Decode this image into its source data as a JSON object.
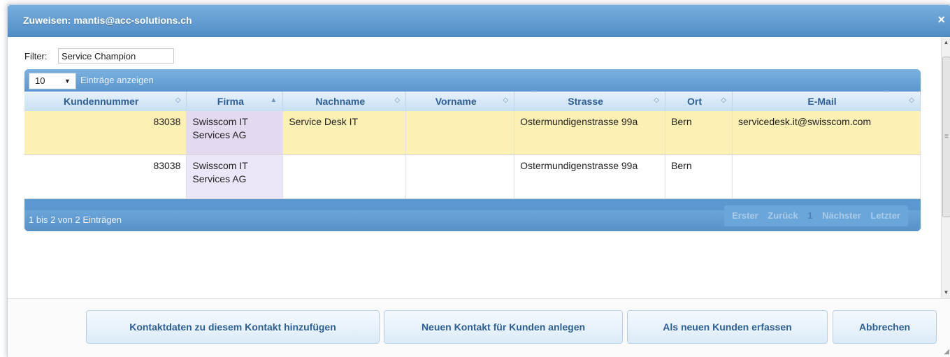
{
  "dialog": {
    "title": "Zuweisen: mantis@acc-solutions.ch",
    "close_glyph": "×"
  },
  "filter": {
    "label": "Filter:",
    "value": "Service Champion"
  },
  "table": {
    "page_size": "10",
    "page_size_label": "Einträge anzeigen",
    "columns": [
      {
        "label": "Kundennummer",
        "sort": "both"
      },
      {
        "label": "Firma",
        "sort": "asc"
      },
      {
        "label": "Nachname",
        "sort": "both"
      },
      {
        "label": "Vorname",
        "sort": "both"
      },
      {
        "label": "Strasse",
        "sort": "both"
      },
      {
        "label": "Ort",
        "sort": "both"
      },
      {
        "label": "E-Mail",
        "sort": "both"
      }
    ],
    "sort_glyphs": {
      "both": "◇",
      "asc": "▲"
    },
    "rows": [
      {
        "kundennummer": "83038",
        "firma": "Swisscom IT Services AG",
        "nachname": "Service Desk IT",
        "vorname": "",
        "strasse": "Ostermundigenstrasse 99a",
        "ort": "Bern",
        "email": "servicedesk.it@swisscom.com",
        "selected": true
      },
      {
        "kundennummer": "83038",
        "firma": "Swisscom IT Services AG",
        "nachname": "",
        "vorname": "",
        "strasse": "Ostermundigenstrasse 99a",
        "ort": "Bern",
        "email": "",
        "selected": false
      }
    ],
    "info": "1 bis 2 von 2 Einträgen",
    "pager": {
      "first": "Erster",
      "prev": "Zurück",
      "current": "1",
      "next": "Nächster",
      "last": "Letzter"
    }
  },
  "buttons": {
    "add_contact_data": "Kontaktdaten zu diesem Kontakt hinzufügen",
    "new_contact": "Neuen Kontakt für Kunden anlegen",
    "new_customer": "Als neuen Kunden erfassen",
    "cancel": "Abbrechen"
  },
  "colors": {
    "titlebar": "#5b98d0",
    "selected_row": "#fcf0b4",
    "sorted_column": "#ece7f8",
    "button_text": "#2d5f94"
  },
  "icons": {
    "close": "close-icon",
    "dropdown": "chevron-down-icon",
    "resize": "resize-grip-icon"
  }
}
